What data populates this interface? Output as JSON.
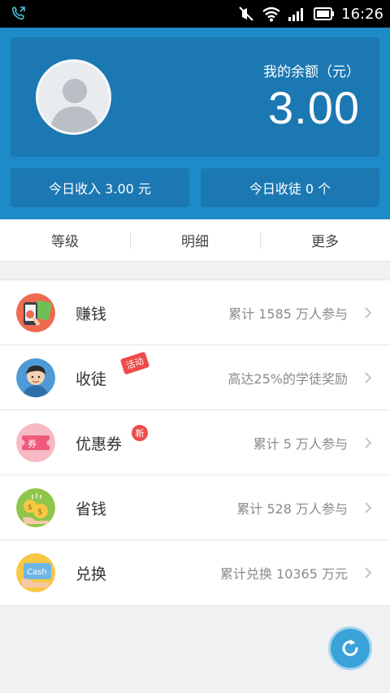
{
  "status_bar": {
    "time": "16:26"
  },
  "header": {
    "balance_label": "我的余额（元）",
    "balance_value": "3.00",
    "today_income": "今日收入 3.00 元",
    "today_apprentice": "今日收徒 0 个"
  },
  "tabs": [
    {
      "label": "等级"
    },
    {
      "label": "明细"
    },
    {
      "label": "更多"
    }
  ],
  "list": [
    {
      "title": "赚钱",
      "desc": "累计 1585 万人参与",
      "icon": "earn-money-icon"
    },
    {
      "title": "收徒",
      "desc": "高达25%的学徒奖励",
      "icon": "apprentice-avatar-icon",
      "badge": "活动"
    },
    {
      "title": "优惠券",
      "desc": "累计 5 万人参与",
      "icon": "coupon-icon",
      "badge": "新"
    },
    {
      "title": "省钱",
      "desc": "累计 528 万人参与",
      "icon": "save-money-icon"
    },
    {
      "title": "兑换",
      "desc": "累计兑换 10365 万元",
      "icon": "cash-card-icon",
      "icon_text": "Cash"
    }
  ],
  "colors": {
    "header_bg": "#1d8bc8",
    "card_bg": "#1b78b2",
    "badge_red": "#ee4b4b",
    "fab": "#3aa2d8"
  }
}
